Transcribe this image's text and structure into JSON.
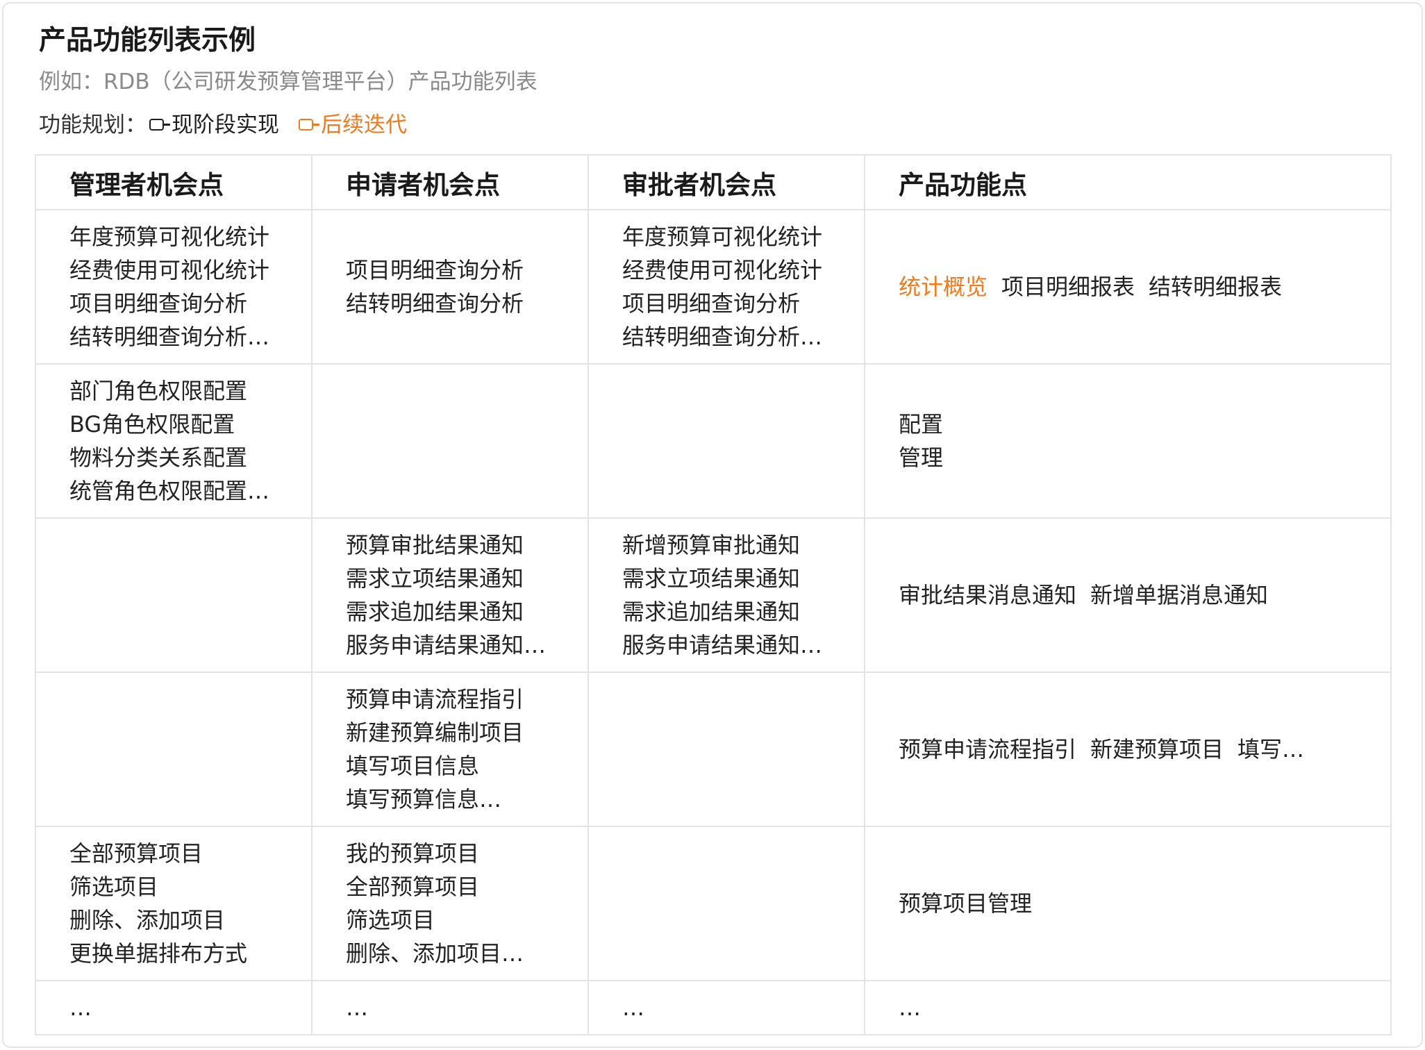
{
  "title": "产品功能列表示例",
  "subtitle": "例如：RDB（公司研发预算管理平台）产品功能列表",
  "plan": {
    "label": "功能规划：",
    "current_label": "现阶段实现",
    "future_label": "后续迭代",
    "current_color": "#1f1f1f",
    "future_color": "#f07a1e"
  },
  "table": {
    "headers": [
      "管理者机会点",
      "申请者机会点",
      "审批者机会点",
      "产品功能点"
    ],
    "rows": [
      {
        "manager": [
          "年度预算可视化统计",
          "经费使用可视化统计",
          "项目明细查询分析",
          "结转明细查询分析…"
        ],
        "applicant": [
          "项目明细查询分析",
          "结转明细查询分析"
        ],
        "approver": [
          "年度预算可视化统计",
          "经费使用可视化统计",
          "项目明细查询分析",
          "结转明细查询分析…"
        ],
        "features": [
          {
            "text": "统计概览",
            "status": "future"
          },
          {
            "text": "项目明细报表",
            "status": "current"
          },
          {
            "text": "结转明细报表",
            "status": "current"
          }
        ]
      },
      {
        "manager": [
          "部门角色权限配置",
          "BG角色权限配置",
          "物料分类关系配置",
          "统管角色权限配置…"
        ],
        "applicant": [],
        "approver": [],
        "features": [
          {
            "text": "配置管理",
            "status": "current"
          }
        ]
      },
      {
        "manager": [],
        "applicant": [
          "预算审批结果通知",
          "需求立项结果通知",
          "需求追加结果通知",
          "服务申请结果通知…"
        ],
        "approver": [
          "新增预算审批通知",
          "需求立项结果通知",
          "需求追加结果通知",
          "服务申请结果通知…"
        ],
        "features": [
          {
            "text": "审批结果消息通知",
            "status": "current"
          },
          {
            "text": "新增单据消息通知",
            "status": "current"
          }
        ]
      },
      {
        "manager": [],
        "applicant": [
          "预算申请流程指引",
          "新建预算编制项目",
          "填写项目信息",
          "填写预算信息…"
        ],
        "approver": [],
        "features": [
          {
            "text": "预算申请流程指引",
            "status": "current"
          },
          {
            "text": "新建预算项目",
            "status": "current"
          },
          {
            "text": "填写…",
            "status": "current"
          }
        ]
      },
      {
        "manager": [
          "全部预算项目",
          "筛选项目",
          "删除、添加项目",
          "更换单据排布方式"
        ],
        "applicant": [
          "我的预算项目",
          "全部预算项目",
          "筛选项目",
          "删除、添加项目…"
        ],
        "approver": [],
        "features": [
          {
            "text": "预算项目管理",
            "status": "current"
          }
        ]
      },
      {
        "manager": [
          "…"
        ],
        "applicant": [
          "…"
        ],
        "approver": [
          "…"
        ],
        "features": [
          {
            "text": "…",
            "status": "current"
          }
        ]
      }
    ]
  }
}
